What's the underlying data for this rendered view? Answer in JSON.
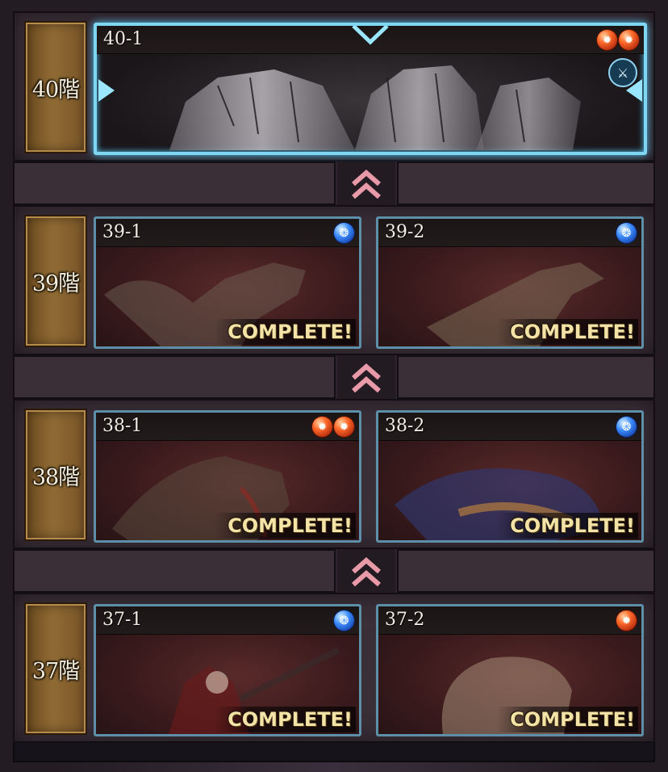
{
  "floors": [
    {
      "label": "40階",
      "stages": [
        {
          "id": "40-1",
          "elements": [
            "fire",
            "fire"
          ],
          "status": "",
          "active": true
        }
      ]
    },
    {
      "label": "39階",
      "stages": [
        {
          "id": "39-1",
          "elements": [
            "water"
          ],
          "status": "COMPLETE!"
        },
        {
          "id": "39-2",
          "elements": [
            "water"
          ],
          "status": "COMPLETE!"
        }
      ]
    },
    {
      "label": "38階",
      "stages": [
        {
          "id": "38-1",
          "elements": [
            "fire",
            "fire"
          ],
          "status": "COMPLETE!"
        },
        {
          "id": "38-2",
          "elements": [
            "water"
          ],
          "status": "COMPLETE!"
        }
      ]
    },
    {
      "label": "37階",
      "stages": [
        {
          "id": "37-1",
          "elements": [
            "water"
          ],
          "status": "COMPLETE!"
        },
        {
          "id": "37-2",
          "elements": [
            "fire"
          ],
          "status": "COMPLETE!"
        }
      ]
    }
  ],
  "icons": {
    "fire": "fire-element-icon",
    "water": "water-element-icon",
    "up": "double-chevron-up-icon",
    "badge": "ten-icon"
  },
  "colors": {
    "active_border": "#7fd6f2",
    "done_border": "#5d8fa8",
    "complete_text": "#f3e3a6",
    "chevron": "#e89aa8"
  }
}
